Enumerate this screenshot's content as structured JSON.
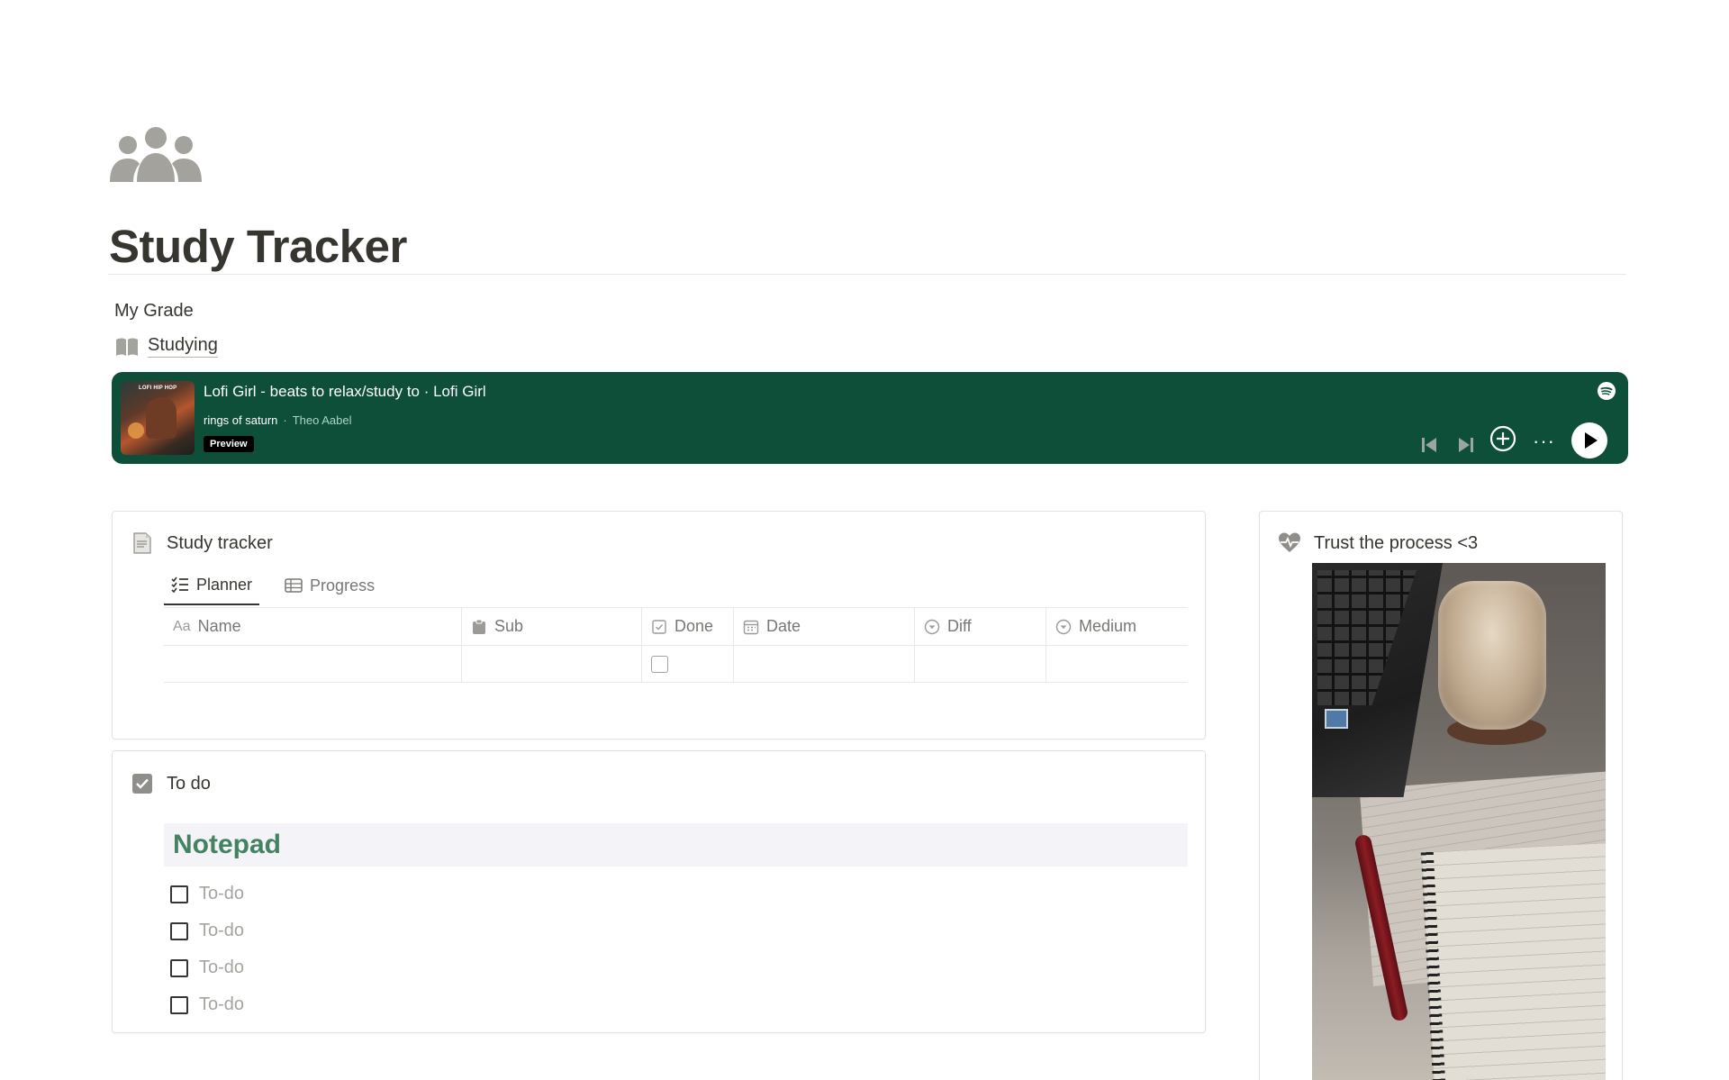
{
  "page": {
    "title": "Study Tracker",
    "icon": "people-group-icon",
    "my_grade": "My Grade",
    "studying_link": "Studying"
  },
  "spotify": {
    "playlist": "Lofi Girl - beats to relax/study to · Lofi Girl",
    "song": "rings of saturn",
    "separator": "·",
    "artist": "Theo Aabel",
    "badge": "Preview",
    "cover_text": "LOFI HIP HOP",
    "more_label": "···",
    "colors": {
      "background": "#0e4f3a",
      "artist": "#a9d7c3"
    }
  },
  "study_tracker": {
    "heading": "Study tracker",
    "tabs": [
      {
        "label": "Planner",
        "active": true,
        "icon": "checklist-icon"
      },
      {
        "label": "Progress",
        "active": false,
        "icon": "table-icon"
      }
    ],
    "columns": [
      {
        "label": "Name",
        "icon": "text-aa-icon",
        "prefix": "Aa"
      },
      {
        "label": "Sub",
        "icon": "clipboard-icon"
      },
      {
        "label": "Done",
        "icon": "checkbox-icon"
      },
      {
        "label": "Date",
        "icon": "calendar-icon"
      },
      {
        "label": "Diff",
        "icon": "select-icon"
      },
      {
        "label": "Medium",
        "icon": "select-icon"
      }
    ],
    "rows": [
      {
        "name": "",
        "sub": "",
        "done": false,
        "date": "",
        "diff": "",
        "medium": ""
      }
    ]
  },
  "todo": {
    "heading": "To do",
    "notepad_title": "Notepad",
    "items": [
      "To-do",
      "To-do",
      "To-do",
      "To-do"
    ],
    "colors": {
      "notepad_bg": "#f4f3f7",
      "notepad_text": "#448361"
    }
  },
  "trust": {
    "heading": "Trust the process <3",
    "icon": "heart-pulse-icon"
  }
}
